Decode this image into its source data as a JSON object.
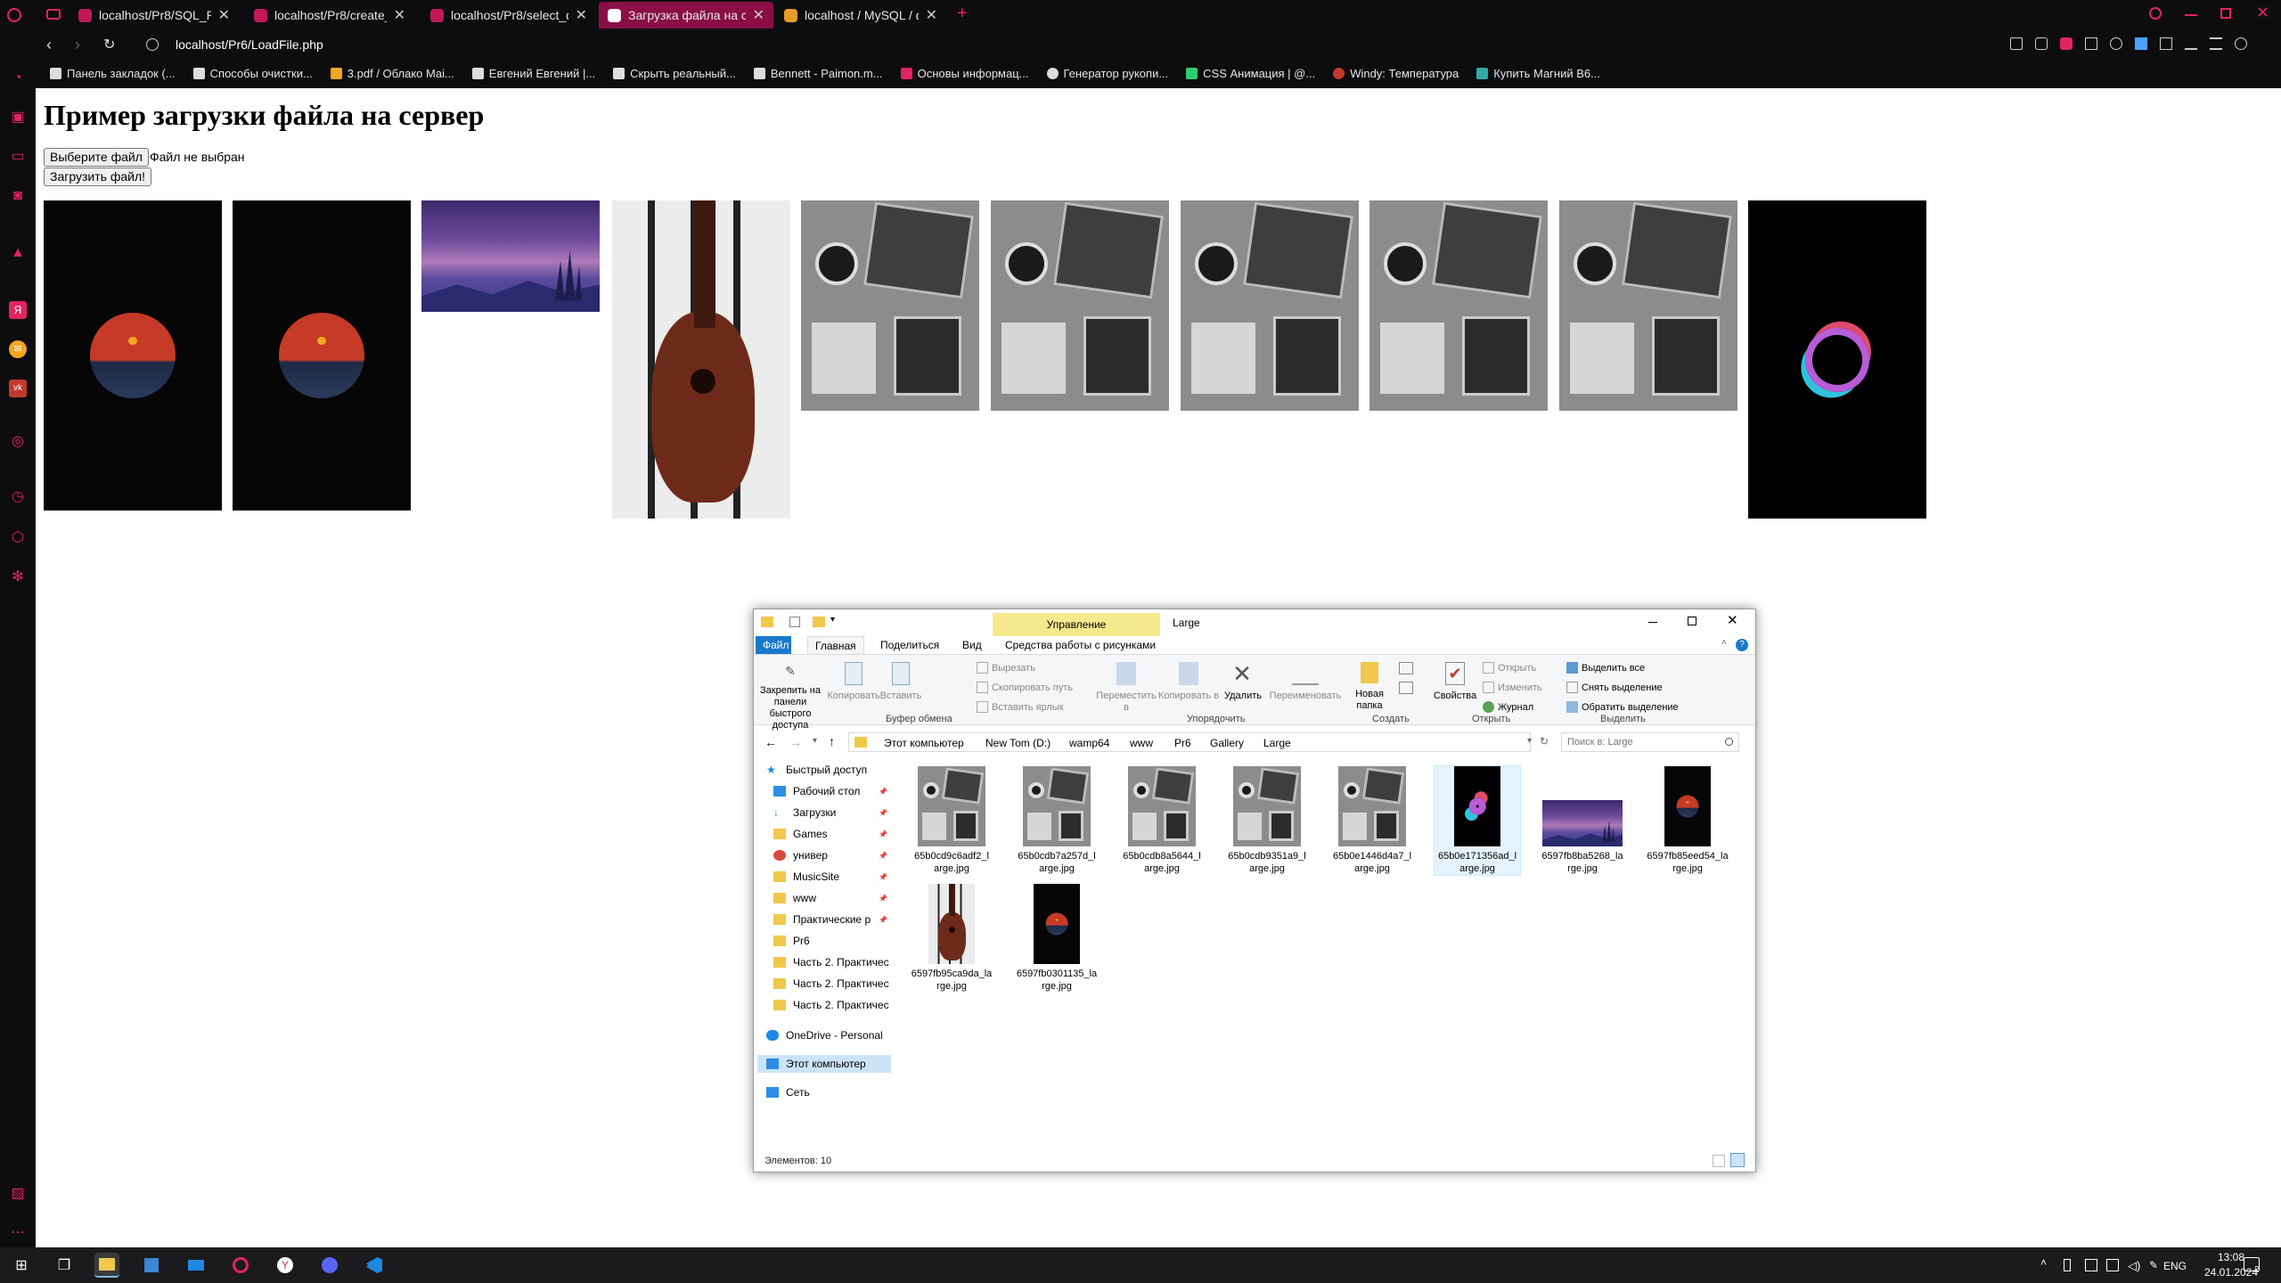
{
  "browser": {
    "tabs": [
      {
        "label": "localhost/Pr8/SQL_PHP.php"
      },
      {
        "label": "localhost/Pr8/create_datab"
      },
      {
        "label": "localhost/Pr8/select_data"
      },
      {
        "label": "Загрузка файла на сервер"
      },
      {
        "label": "localhost / MySQL / databa"
      }
    ],
    "new_tab": "+",
    "close_glyph": "✕",
    "url": "localhost/Pr6/LoadFile.php",
    "bookmarks": [
      "Панель закладок (...",
      "Способы очистки...",
      "3.pdf / Облако Mai...",
      "Евгений Евгений |...",
      "Скрыть реальный...",
      "Bennett - Paimon.m...",
      "Основы информац...",
      "Генератор рукопи...",
      "CSS Анимация | @...",
      "Windy: Температура",
      "Купить Магний B6..."
    ]
  },
  "page": {
    "heading": "Пример загрузки файла на сервер",
    "choose_button": "Выберите файл",
    "no_file": "Файл не выбран",
    "upload_button": "Загрузить файл!"
  },
  "gallery": [
    {
      "kind": "sunset"
    },
    {
      "kind": "sunset"
    },
    {
      "kind": "mountain"
    },
    {
      "kind": "guitar"
    },
    {
      "kind": "desk"
    },
    {
      "kind": "desk"
    },
    {
      "kind": "desk"
    },
    {
      "kind": "desk"
    },
    {
      "kind": "desk"
    },
    {
      "kind": "logo"
    }
  ],
  "explorer": {
    "title": "Large",
    "manage_tab": "Управление",
    "ribbon_tabs": [
      "Файл",
      "Главная",
      "Поделиться",
      "Вид",
      "Средства работы с рисунками"
    ],
    "ribbon": {
      "pin": "Закрепить на панели быстрого доступа",
      "copy": "Копировать",
      "paste": "Вставить",
      "cut": "Вырезать",
      "copy_path": "Скопировать путь",
      "paste_shortcut": "Вставить ярлык",
      "move_to": "Переместить в",
      "copy_to": "Копировать в",
      "delete": "Удалить",
      "rename": "Переименовать",
      "new_folder": "Новая папка",
      "properties": "Свойства",
      "open": "Открыть",
      "edit": "Изменить",
      "history": "Журнал",
      "select_all": "Выделить все",
      "select_none": "Снять выделение",
      "invert": "Обратить выделение",
      "groups": [
        "Буфер обмена",
        "Упорядочить",
        "Создать",
        "Открыть",
        "Выделить"
      ]
    },
    "breadcrumbs": [
      "Этот компьютер",
      "New Tom (D:)",
      "wamp64",
      "www",
      "Pr6",
      "Gallery",
      "Large"
    ],
    "search_placeholder": "Поиск в: Large",
    "nav": [
      {
        "label": "Быстрый доступ",
        "icon": "star"
      },
      {
        "label": "Рабочий стол",
        "icon": "desktop"
      },
      {
        "label": "Загрузки",
        "icon": "download"
      },
      {
        "label": "Games",
        "icon": "folder"
      },
      {
        "label": "универ",
        "icon": "app"
      },
      {
        "label": "MusicSite",
        "icon": "folder"
      },
      {
        "label": "www",
        "icon": "folder"
      },
      {
        "label": "Практические р",
        "icon": "folder"
      },
      {
        "label": "Pr6",
        "icon": "folder"
      },
      {
        "label": "Часть 2. Практичес",
        "icon": "folder"
      },
      {
        "label": "Часть 2. Практичес",
        "icon": "folder"
      },
      {
        "label": "Часть 2. Практичес",
        "icon": "folder"
      },
      {
        "label": "OneDrive - Personal",
        "icon": "cloud"
      },
      {
        "label": "Этот компьютер",
        "icon": "pc"
      },
      {
        "label": "Сеть",
        "icon": "network"
      }
    ],
    "files": [
      {
        "line1": "65b0cd9c6adf2_l",
        "line2": "arge.jpg",
        "kind": "desk"
      },
      {
        "line1": "65b0cdb7a257d_l",
        "line2": "arge.jpg",
        "kind": "desk"
      },
      {
        "line1": "65b0cdb8a5644_l",
        "line2": "arge.jpg",
        "kind": "desk"
      },
      {
        "line1": "65b0cdb9351a9_l",
        "line2": "arge.jpg",
        "kind": "desk"
      },
      {
        "line1": "65b0e1446d4a7_l",
        "line2": "arge.jpg",
        "kind": "desk"
      },
      {
        "line1": "65b0e171356ad_l",
        "line2": "arge.jpg",
        "kind": "logo"
      },
      {
        "line1": "6597fb8ba5268_la",
        "line2": "rge.jpg",
        "kind": "mountain"
      },
      {
        "line1": "6597fb85eed54_la",
        "line2": "rge.jpg",
        "kind": "sunset"
      },
      {
        "line1": "6597fb95ca9da_la",
        "line2": "rge.jpg",
        "kind": "guitar"
      },
      {
        "line1": "6597fb0301135_la",
        "line2": "rge.jpg",
        "kind": "sunset"
      }
    ],
    "status": "Элементов: 10"
  },
  "taskbar": {
    "lang": "ENG",
    "time": "13:08",
    "date": "24.01.2024",
    "notif_count": "2"
  }
}
